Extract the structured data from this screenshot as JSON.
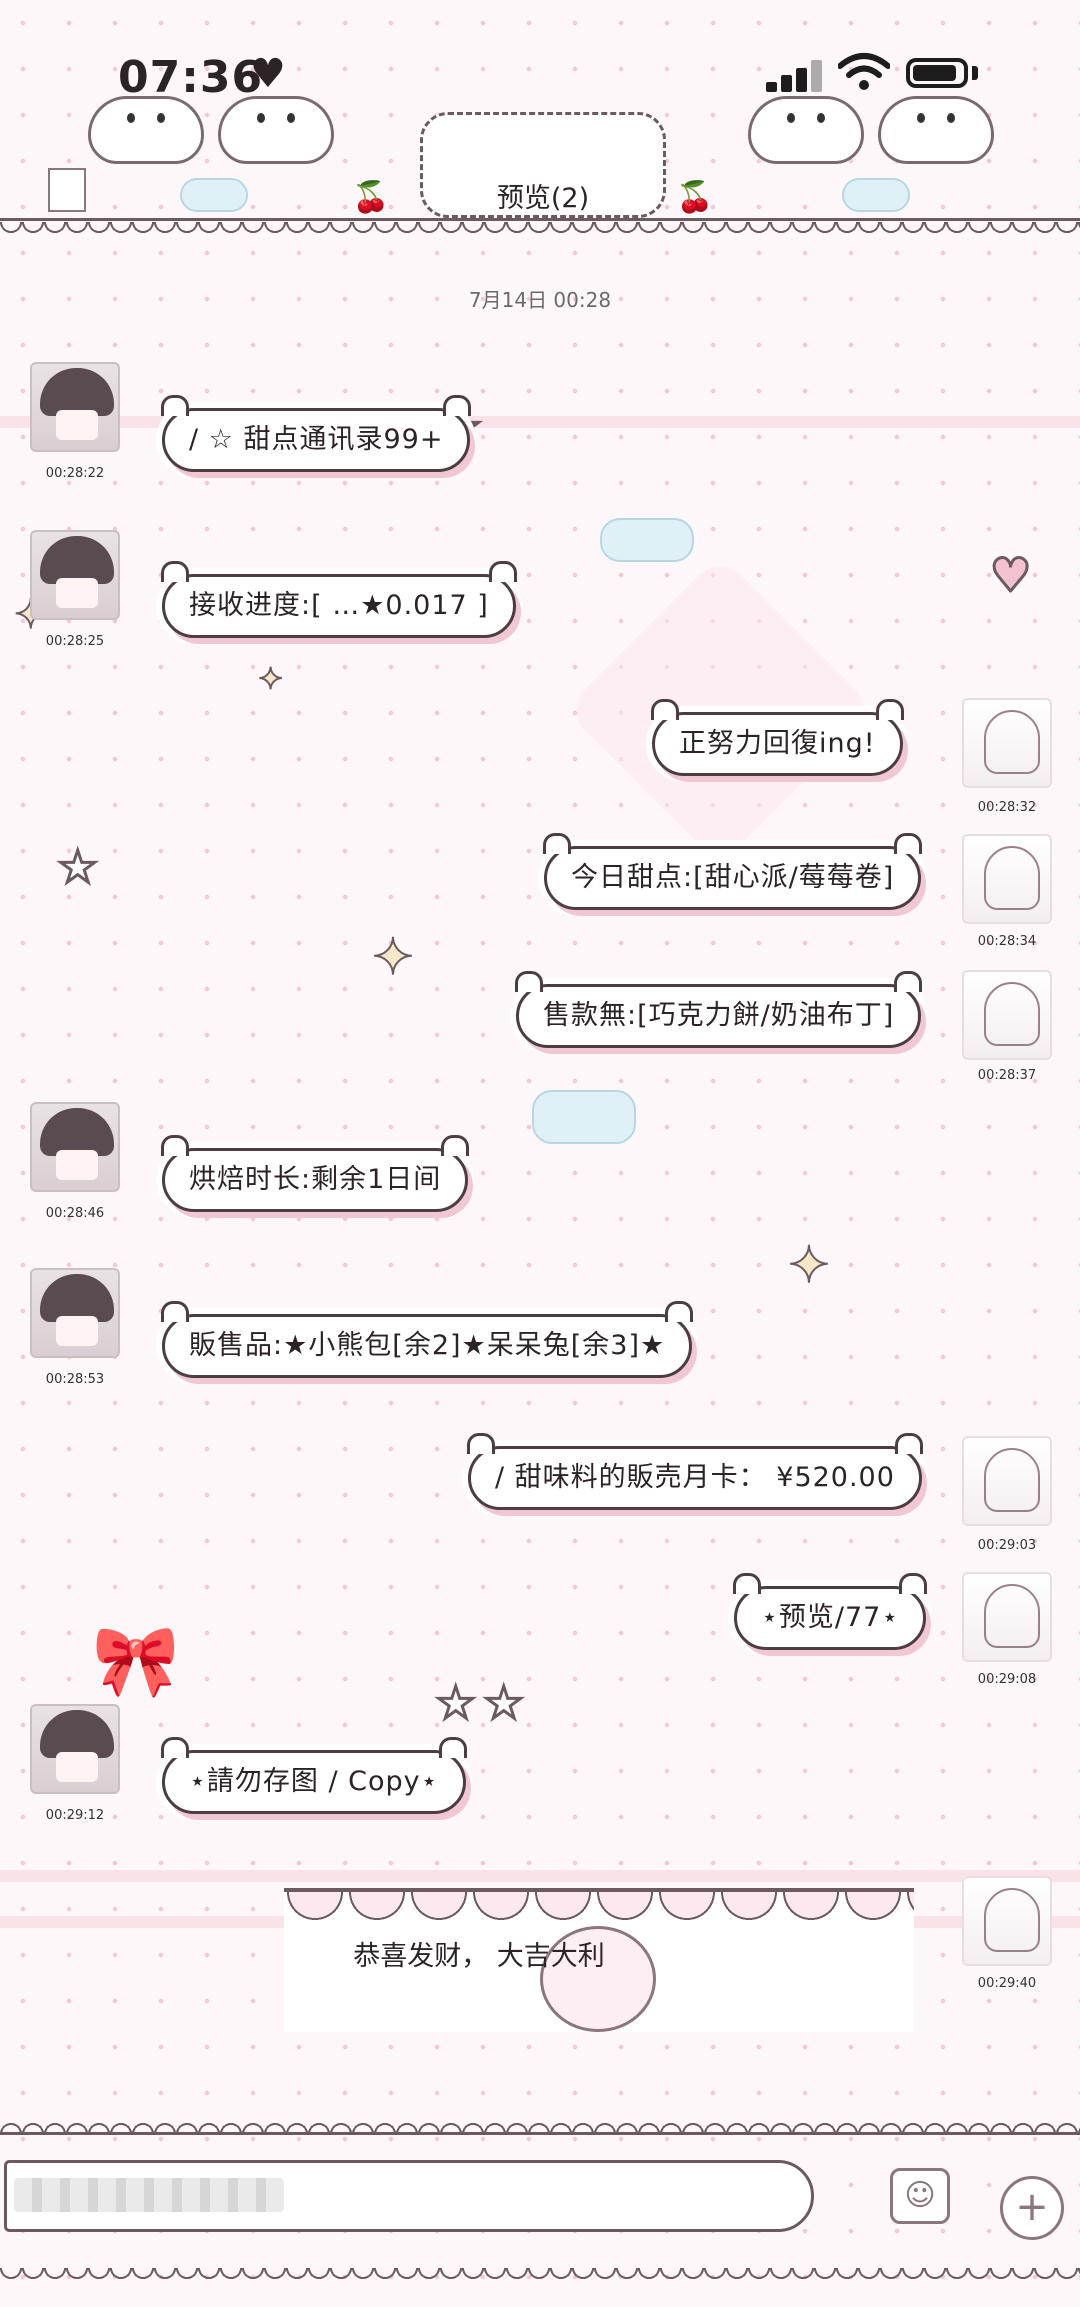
{
  "status_bar": {
    "time": "07:36",
    "heart_icon": "♥",
    "signal_icon": "signal-icon",
    "wifi_icon": "wifi-icon",
    "battery_level": 0.9
  },
  "header": {
    "title": "预览(2)"
  },
  "chat": {
    "date": "7月14日 00:28",
    "messages": [
      {
        "side": "left",
        "text": "/ ☆ 甜点通讯录99+",
        "time": "00:28:22"
      },
      {
        "side": "left",
        "text": "接收进度:[ …★0.017  ]",
        "time": "00:28:25"
      },
      {
        "side": "right",
        "text": "正努力回復ing!",
        "time": "00:28:32"
      },
      {
        "side": "right",
        "text": "今日甜点:[甜心派/莓莓卷]",
        "time": "00:28:34"
      },
      {
        "side": "right",
        "text": "售款無:[巧克力餅/奶油布丁]",
        "time": "00:28:37"
      },
      {
        "side": "left",
        "text": "烘焙时长:剩余1日间",
        "time": "00:28:46"
      },
      {
        "side": "left",
        "text": "販售品:★小熊包[余2]★呆呆兔[余3]★",
        "time": "00:28:53"
      },
      {
        "side": "right",
        "text": "/ 甜味料的販売月卡： ¥520.00",
        "time": "00:29:03"
      },
      {
        "side": "right",
        "text": "⋆预览/77⋆",
        "time": "00:29:08"
      },
      {
        "side": "left",
        "text": "⋆請勿存图 / Copy⋆",
        "time": "00:29:12"
      }
    ],
    "banner": {
      "text": "恭喜发财， 大吉大利",
      "time": "00:29:40"
    }
  },
  "input_bar": {
    "emoji_icon": "☺",
    "plus_icon": "+"
  },
  "colors": {
    "outline": "#4b3d42",
    "bubble_shadow": "#f2c7d4",
    "background": "#fdf7f9",
    "accent_pink": "#f2a7bb"
  }
}
